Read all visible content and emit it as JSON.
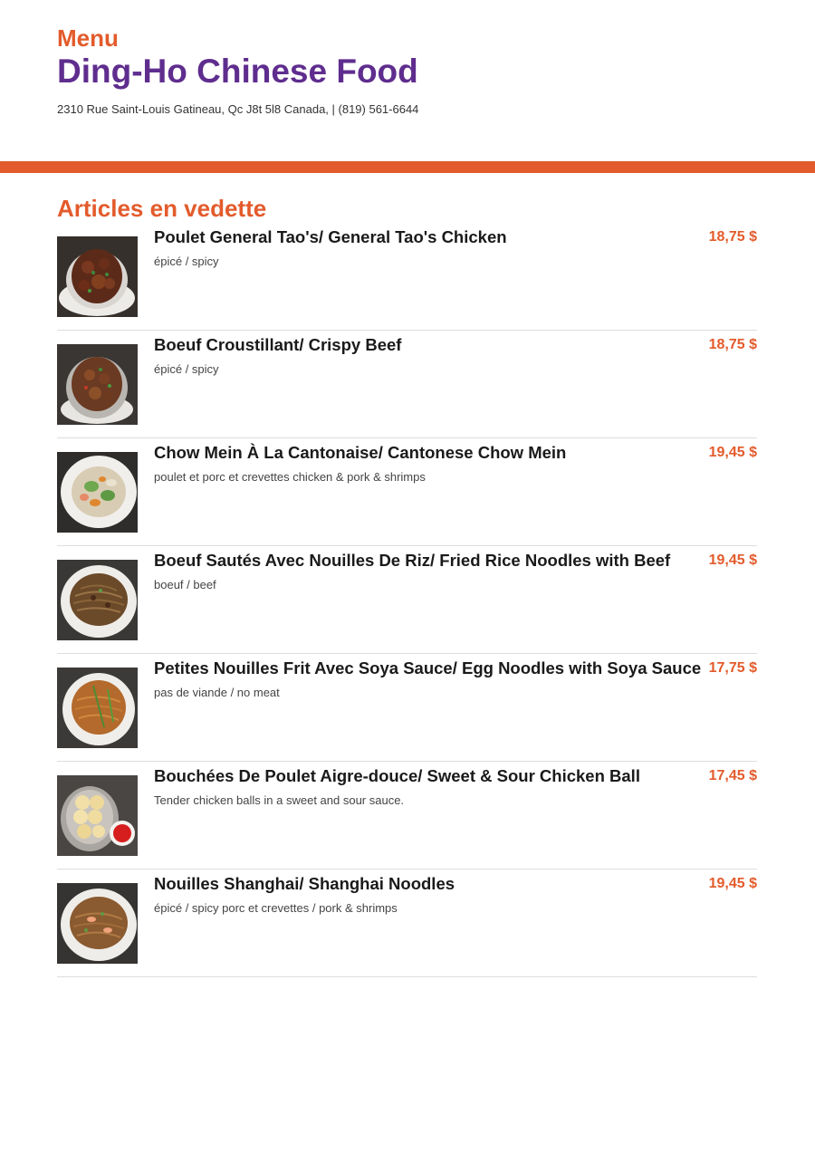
{
  "header": {
    "menu_label": "Menu",
    "restaurant_name": "Ding-Ho Chinese Food",
    "address": "2310 Rue Saint-Louis Gatineau, Qc J8t 5l8 Canada, | (819) 561-6644"
  },
  "colors": {
    "accent": "#e35b2c",
    "brand_purple": "#5f2d8e",
    "divider": "#dddddd"
  },
  "section": {
    "title": "Articles en vedette"
  },
  "items": [
    {
      "name": "Poulet General Tao's/ General Tao's Chicken",
      "description": "épicé / spicy",
      "price": "18,75 $",
      "image": "general-tao-chicken-photo"
    },
    {
      "name": "Boeuf Croustillant/ Crispy Beef",
      "description": "épicé / spicy",
      "price": "18,75 $",
      "image": "crispy-beef-photo"
    },
    {
      "name": "Chow Mein À La Cantonaise/ Cantonese Chow Mein",
      "description": "poulet et porc et crevettes chicken & pork & shrimps",
      "price": "19,45 $",
      "image": "cantonese-chow-mein-photo"
    },
    {
      "name": "Boeuf Sautés Avec Nouilles De Riz/ Fried Rice Noodles with Beef",
      "description": "boeuf / beef",
      "price": "19,45 $",
      "image": "rice-noodles-beef-photo"
    },
    {
      "name": "Petites Nouilles Frit Avec Soya Sauce/ Egg Noodles with Soya Sauce",
      "description": "pas de viande / no meat",
      "price": "17,75 $",
      "image": "egg-noodles-soya-photo"
    },
    {
      "name": "Bouchées De Poulet Aigre-douce/ Sweet & Sour Chicken Ball",
      "description": "Tender chicken balls in a sweet and sour sauce.",
      "price": "17,45 $",
      "image": "sweet-sour-chicken-ball-photo"
    },
    {
      "name": "Nouilles Shanghai/ Shanghai Noodles",
      "description": "épicé / spicy porc et crevettes / pork & shrimps",
      "price": "19,45 $",
      "image": "shanghai-noodles-photo"
    }
  ]
}
